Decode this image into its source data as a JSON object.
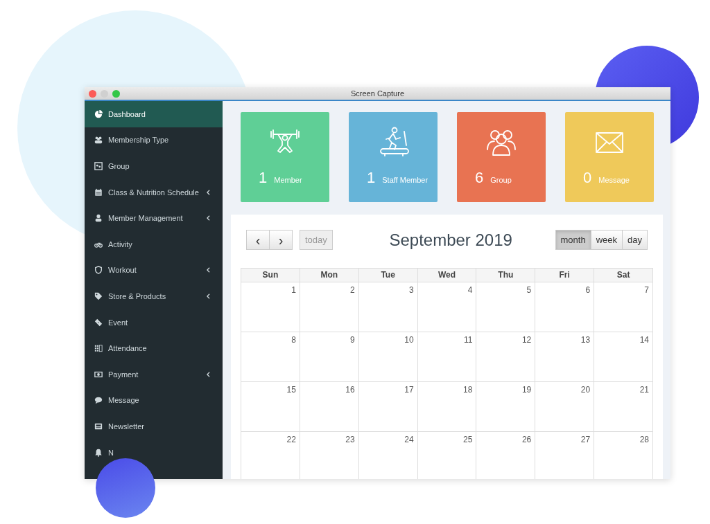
{
  "window": {
    "title": "Screen Capture"
  },
  "sidebar": {
    "items": [
      {
        "label": "Dashboard",
        "submenu": false,
        "selected": true
      },
      {
        "label": "Membership Type",
        "submenu": false,
        "selected": false
      },
      {
        "label": "Group",
        "submenu": false,
        "selected": false
      },
      {
        "label": "Class & Nutrition Schedule",
        "submenu": true,
        "selected": false
      },
      {
        "label": "Member Management",
        "submenu": true,
        "selected": false
      },
      {
        "label": "Activity",
        "submenu": false,
        "selected": false
      },
      {
        "label": "Workout",
        "submenu": true,
        "selected": false
      },
      {
        "label": "Store & Products",
        "submenu": true,
        "selected": false
      },
      {
        "label": "Event",
        "submenu": false,
        "selected": false
      },
      {
        "label": "Attendance",
        "submenu": false,
        "selected": false
      },
      {
        "label": "Payment",
        "submenu": true,
        "selected": false
      },
      {
        "label": "Message",
        "submenu": false,
        "selected": false
      },
      {
        "label": "Newsletter",
        "submenu": false,
        "selected": false
      },
      {
        "label": "N",
        "submenu": false,
        "selected": false
      }
    ]
  },
  "stats": [
    {
      "count": "1",
      "label": "Member",
      "color": "#5fcf96"
    },
    {
      "count": "1",
      "label": "Staff Member",
      "color": "#66b4d8"
    },
    {
      "count": "6",
      "label": "Group",
      "color": "#e87352"
    },
    {
      "count": "0",
      "label": "Message",
      "color": "#efc95a"
    }
  ],
  "calendar": {
    "title": "September 2019",
    "prev": "‹",
    "next": "›",
    "today": "today",
    "views": [
      {
        "label": "month",
        "selected": true
      },
      {
        "label": "week",
        "selected": false
      },
      {
        "label": "day",
        "selected": false
      }
    ],
    "weekdays": [
      "Sun",
      "Mon",
      "Tue",
      "Wed",
      "Thu",
      "Fri",
      "Sat"
    ],
    "weeks": [
      [
        "1",
        "2",
        "3",
        "4",
        "5",
        "6",
        "7"
      ],
      [
        "8",
        "9",
        "10",
        "11",
        "12",
        "13",
        "14"
      ],
      [
        "15",
        "16",
        "17",
        "18",
        "19",
        "20",
        "21"
      ],
      [
        "22",
        "23",
        "24",
        "25",
        "26",
        "27",
        "28"
      ]
    ]
  }
}
